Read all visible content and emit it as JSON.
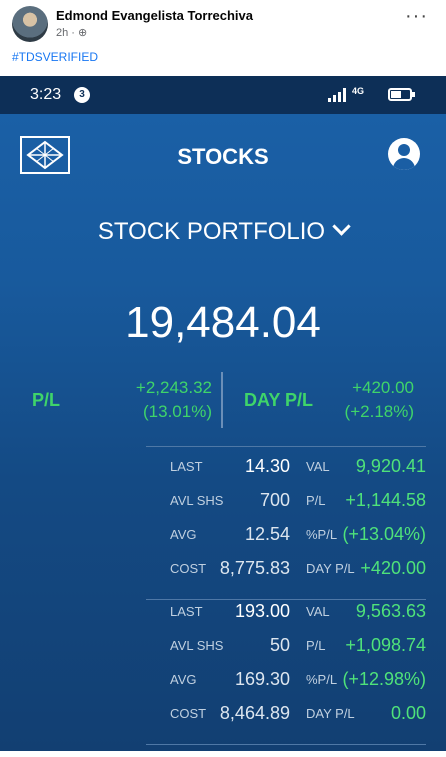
{
  "post": {
    "author": "Edmond Evangelista Torrechiva",
    "time": "2h ·",
    "hashtag": "#TDSVERIFIED"
  },
  "status_bar": {
    "time": "3:23",
    "notification_count": "3",
    "network": "4G"
  },
  "app": {
    "title": "STOCKS",
    "portfolio_selector": "STOCK PORTFOLIO",
    "total_value": "19,484.04",
    "pl_label": "P/L",
    "pl_amount": "+2,243.32",
    "pl_percent": "(13.01%)",
    "day_pl_label": "DAY P/L",
    "day_pl_amount": "+420.00",
    "day_pl_percent": "(+2.18%)",
    "colors": {
      "accent_green": "#3fd46a",
      "background_blue": "#185a9d"
    }
  },
  "holdings": [
    {
      "last_label": "LAST",
      "last": "14.30",
      "val_label": "VAL",
      "val": "9,920.41",
      "avl_shs_label": "AVL SHS",
      "avl_shs": "700",
      "pl_label": "P/L",
      "pl": "+1,144.58",
      "avg_label": "AVG",
      "avg": "12.54",
      "pct_pl_label": "%P/L",
      "pct_pl": "(+13.04%)",
      "cost_label": "COST",
      "cost": "8,775.83",
      "day_pl_label": "DAY P/L",
      "day_pl": "+420.00"
    },
    {
      "last_label": "LAST",
      "last": "193.00",
      "val_label": "VAL",
      "val": "9,563.63",
      "avl_shs_label": "AVL SHS",
      "avl_shs": "50",
      "pl_label": "P/L",
      "pl": "+1,098.74",
      "avg_label": "AVG",
      "avg": "169.30",
      "pct_pl_label": "%P/L",
      "pct_pl": "(+12.98%)",
      "cost_label": "COST",
      "cost": "8,464.89",
      "day_pl_label": "DAY P/L",
      "day_pl": "0.00"
    }
  ]
}
